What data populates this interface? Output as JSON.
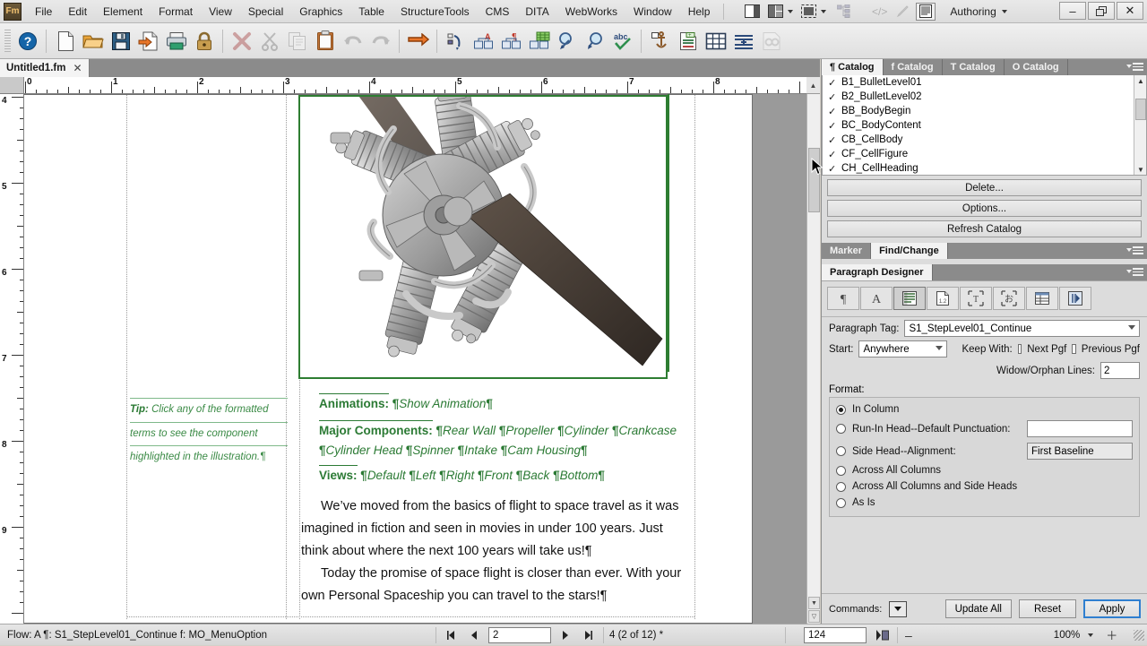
{
  "app": {
    "logo": "Fm",
    "title": "Untitled1.fm",
    "workspace": "Authoring"
  },
  "menubar": {
    "items": [
      "File",
      "Edit",
      "Element",
      "Format",
      "View",
      "Special",
      "Graphics",
      "Table",
      "StructureTools",
      "CMS",
      "DITA",
      "WebWorks",
      "Window",
      "Help"
    ],
    "right_icons": [
      "panel-layout-icon",
      "split-view-icon",
      "chevron-down-icon",
      "pod-view-icon",
      "chevron-down-icon",
      "structure-tree-icon",
      "code-view-icon",
      "pencil-icon",
      "wysiwyg-view-icon"
    ],
    "workspace_label": "Authoring",
    "window_buttons": [
      "minimize-button",
      "restore-button",
      "close-button"
    ],
    "window_glyphs": [
      "–",
      "❐",
      "✕"
    ]
  },
  "toolbar": {
    "groups": [
      [
        "help-icon"
      ],
      [
        "new-document-icon",
        "open-folder-icon",
        "save-icon",
        "save-as-icon",
        "print-icon",
        "lock-icon"
      ],
      [
        "delete-icon",
        "cut-icon",
        "copy-icon",
        "paste-icon",
        "undo-icon",
        "redo-icon",
        "redo-arrow-icon"
      ],
      [
        "structure-insert-icon",
        "element-attribute-icon",
        "element-paragraph-icon",
        "element-table-icon",
        "zoom-in-icon",
        "zoom-out-icon",
        "spellcheck-icon"
      ],
      [
        "anchor-icon",
        "insert-footnote-icon",
        "insert-table-icon",
        "insert-line-icon",
        "compare-docs-icon"
      ]
    ]
  },
  "ruler": {
    "horizontal_labels": [
      "0",
      "1",
      "2",
      "3",
      "4",
      "5",
      "6",
      "7",
      "8"
    ],
    "vertical_labels": [
      "4",
      "5",
      "6",
      "7",
      "8",
      "9"
    ],
    "units": "inches"
  },
  "document": {
    "figure": {
      "name": "radial-aircraft-engine-3d-figure",
      "caption": ""
    },
    "tip": {
      "label": "Tip:",
      "lines": [
        "Click any of the formatted",
        "terms to see the component",
        "highlighted in the illustration.¶"
      ]
    },
    "link_paragraphs": [
      {
        "label": "Animations:",
        "items": [
          "Show Animation"
        ]
      },
      {
        "label": "Major Components:",
        "items": [
          "Rear Wall",
          "Propeller",
          "Cylinder",
          "Crankcase",
          "Cylinder Head",
          "Spinner",
          "Intake",
          "Cam Housing"
        ]
      },
      {
        "label": "Views:",
        "items": [
          "Default",
          "Left",
          "Right",
          "Front",
          "Back",
          "Bottom"
        ]
      }
    ],
    "body_paragraphs": [
      "We’ve moved from the basics of flight to space travel as it was imagined in fiction and seen in movies in under 100 years. Just think about where the next 100 years will take us!¶",
      "Today the promise of space flight is closer than ever. With your own Personal Spaceship you can travel to the stars!¶"
    ]
  },
  "catalog_panel": {
    "tabs": [
      {
        "label": "¶ Catalog",
        "active": true
      },
      {
        "label": "f Catalog",
        "active": false
      },
      {
        "label": "T Catalog",
        "active": false
      },
      {
        "label": "O Catalog",
        "active": false
      }
    ],
    "items": [
      {
        "check": "✓",
        "name": "B1_BulletLevel01"
      },
      {
        "check": "✓",
        "name": "B2_BulletLevel02"
      },
      {
        "check": "✓",
        "name": "BB_BodyBegin"
      },
      {
        "check": "✓",
        "name": "BC_BodyContent"
      },
      {
        "check": "✓",
        "name": "CB_CellBody"
      },
      {
        "check": "✓",
        "name": "CF_CellFigure"
      },
      {
        "check": "✓",
        "name": "CH_CellHeading"
      }
    ],
    "buttons": [
      "Delete...",
      "Options...",
      "Refresh Catalog"
    ]
  },
  "find_panel": {
    "tabs": [
      {
        "label": "Marker",
        "active": false
      },
      {
        "label": "Find/Change",
        "active": true
      }
    ]
  },
  "paragraph_designer": {
    "tab_label": "Paragraph Designer",
    "property_icons": [
      "basic-properties-icon",
      "default-font-icon",
      "pagination-icon",
      "numbering-icon",
      "advanced-icon",
      "asian-typography-icon",
      "table-cell-icon",
      "direction-icon"
    ],
    "selected_property_icon_index": 2,
    "paragraph_tag_label": "Paragraph Tag:",
    "paragraph_tag_value": "S1_StepLevel01_Continue",
    "start_label": "Start:",
    "start_value": "Anywhere",
    "keep_with_label": "Keep With:",
    "keep_with_next": {
      "label": "Next Pgf",
      "checked": false
    },
    "keep_with_previous": {
      "label": "Previous Pgf",
      "checked": false
    },
    "widow_orphan_label": "Widow/Orphan Lines:",
    "widow_orphan_value": "2",
    "format_label": "Format:",
    "format_options": [
      {
        "label": "In Column",
        "selected": true,
        "control": "none"
      },
      {
        "label": "Run-In Head--Default Punctuation:",
        "selected": false,
        "control": "text",
        "value": ""
      },
      {
        "label": "Side Head--Alignment:",
        "selected": false,
        "control": "select",
        "value": "First Baseline"
      },
      {
        "label": "Across All Columns",
        "selected": false,
        "control": "none"
      },
      {
        "label": "Across All Columns and Side Heads",
        "selected": false,
        "control": "none"
      },
      {
        "label": "As Is",
        "selected": false,
        "control": "none"
      }
    ],
    "commands_label": "Commands:",
    "buttons": [
      {
        "label": "Update All",
        "primary": false
      },
      {
        "label": "Reset",
        "primary": false
      },
      {
        "label": "Apply",
        "primary": true
      }
    ]
  },
  "statusbar": {
    "flow_text": "Flow: A  ¶: S1_StepLevel01_Continue  f: MO_MenuOption",
    "page_value": "2",
    "page_info": "4 (2 of 12) *",
    "object_count": "124",
    "zoom_value": "100%",
    "nav_icons": [
      "first-page-icon",
      "previous-page-icon",
      "next-page-icon",
      "last-page-icon"
    ],
    "nav_glyphs": [
      "⏮",
      "◀",
      "▶",
      "⏭"
    ],
    "zoom_out_glyph": "–",
    "zoom_in_glyph": "＋"
  },
  "colors": {
    "accent_blue": "#2f7fd0",
    "link_green": "#2b7a34",
    "panel_bg": "#dcdcdc",
    "chrome_bg": "#e2e2e2",
    "tab_inactive": "#8b8b8b"
  }
}
